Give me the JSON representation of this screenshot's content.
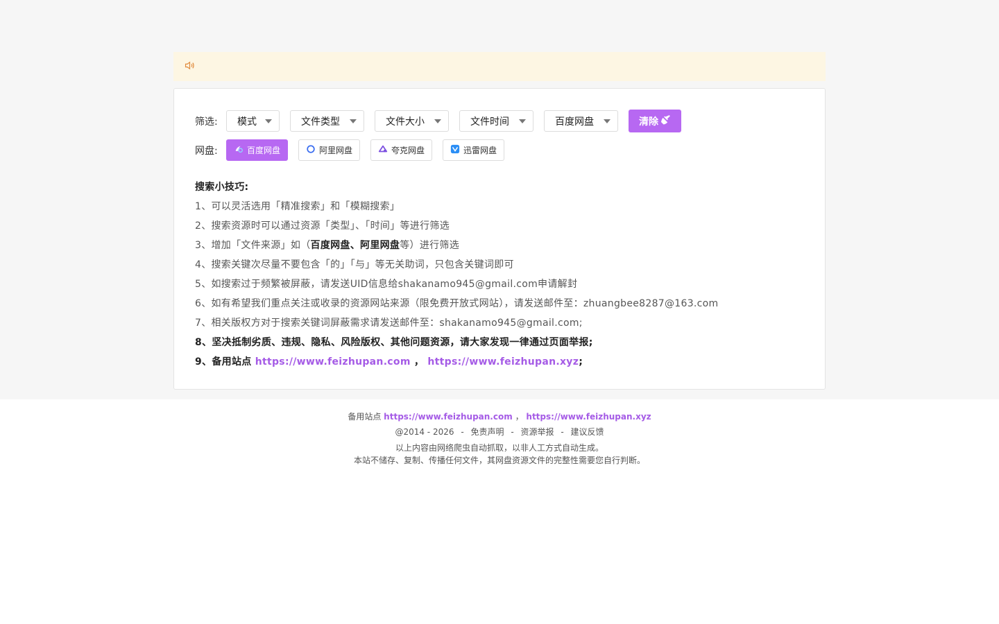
{
  "filter": {
    "label": "筛选:",
    "dropdowns": [
      "模式",
      "文件类型",
      "文件大小",
      "文件时间",
      "百度网盘"
    ],
    "clear_label": "清除"
  },
  "pan": {
    "label": "网盘:",
    "items": [
      "百度网盘",
      "阿里网盘",
      "夸克网盘",
      "迅雷网盘"
    ]
  },
  "tips": {
    "title": "搜索小技巧:",
    "l1": "1、可以灵活选用「精准搜索」和「模糊搜索」",
    "l2": "2、搜索资源时可以通过资源「类型」、「时间」等进行筛选",
    "l3_pre": "3、增加「文件来源」如（",
    "l3_b1": "百度网盘",
    "l3_mid": "、",
    "l3_b2": "阿里网盘",
    "l3_post": "等）进行筛选",
    "l4": "4、搜索关键次尽量不要包含「的」「与」等无关助词，只包含关键词即可",
    "l5": "5、如搜索过于频繁被屏蔽，请发送UID信息给shakanamo945@gmail.com申请解封",
    "l6": "6、如有希望我们重点关注或收录的资源网站来源（限免费开放式网站），请发送邮件至：zhuangbee8287@163.com",
    "l7": "7、相关版权方对于搜索关键词屏蔽需求请发送邮件至：shakanamo945@gmail.com;",
    "l8": "8、坚决抵制劣质、违规、隐私、风险版权、其他问题资源，请大家发现一律通过页面举报;",
    "l9_pre": "9、备用站点",
    "l9_link1": "https://www.feizhupan.com",
    "l9_sep": "，",
    "l9_link2": "https://www.feizhupan.xyz",
    "l9_post": ";"
  },
  "footer": {
    "backup_label": "备用站点",
    "link1": "https://www.feizhupan.com",
    "comma": "，",
    "link2": "https://www.feizhupan.xyz",
    "copyright": "@2014 - 2026",
    "disclaimer": "免责声明",
    "report": "资源举报",
    "feedback": "建议反馈",
    "dash": "-",
    "note1": "以上内容由网络爬虫自动抓取，以非人工方式自动生成。",
    "note2": "本站不储存、复制、传播任何文件，其网盘资源文件的完整性需要您自行判断。"
  },
  "colors": {
    "accent": "#b768f2",
    "link": "#a55be6",
    "notice_bg": "#fdf6e3"
  },
  "icons": {
    "notice": "speaker-icon",
    "clear": "broom-icon",
    "baidu": "baidu-pan-icon",
    "ali": "ali-pan-icon",
    "quark": "quark-pan-icon",
    "xunlei": "xunlei-pan-icon"
  }
}
